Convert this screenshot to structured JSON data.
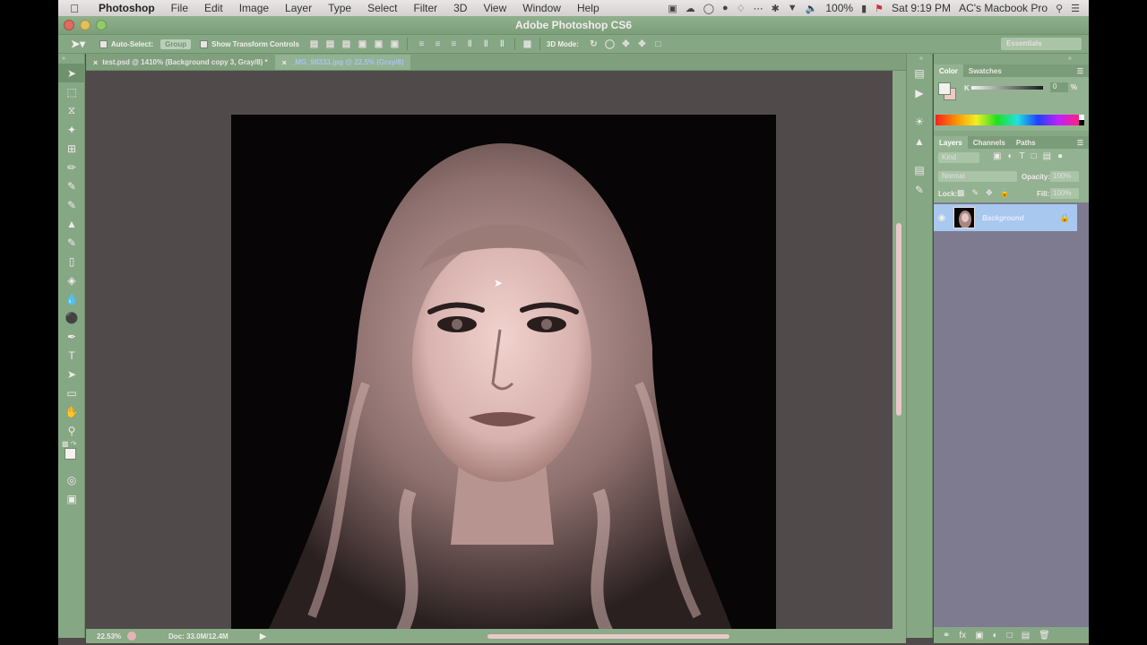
{
  "menubar": {
    "apple": "",
    "items": [
      "Photoshop",
      "File",
      "Edit",
      "Image",
      "Layer",
      "Type",
      "Select",
      "Filter",
      "3D",
      "View",
      "Window",
      "Help"
    ],
    "battery": "100%",
    "clock": "Sat 9:19 PM",
    "user": "AC's Macbook Pro"
  },
  "window": {
    "title": "Adobe Photoshop CS6"
  },
  "options": {
    "auto_select_label": "Auto-Select:",
    "auto_select_value": "Group",
    "transform_label": "Show Transform Controls",
    "mode_3d_label": "3D Mode:",
    "workspace": "Essentials"
  },
  "tabs": [
    {
      "label": "test.psd @ 1410% (Background copy 3, Gray/8) *",
      "active": false
    },
    {
      "label": "_MG_98333.jpg @ 22.5% (Gray/8)",
      "active": true
    }
  ],
  "status": {
    "zoom": "22.53%",
    "doc": "Doc: 33.0M/12.4M"
  },
  "color_panel": {
    "tabs": [
      "Color",
      "Swatches"
    ],
    "channel": "K",
    "value": "0",
    "unit": "%"
  },
  "layers_panel": {
    "tabs": [
      "Layers",
      "Channels",
      "Paths"
    ],
    "kind": "Kind",
    "blend_mode": "Normal",
    "opacity_label": "Opacity:",
    "opacity": "100%",
    "lock_label": "Lock:",
    "fill_label": "Fill:",
    "fill": "100%",
    "layer_name": "Background"
  }
}
